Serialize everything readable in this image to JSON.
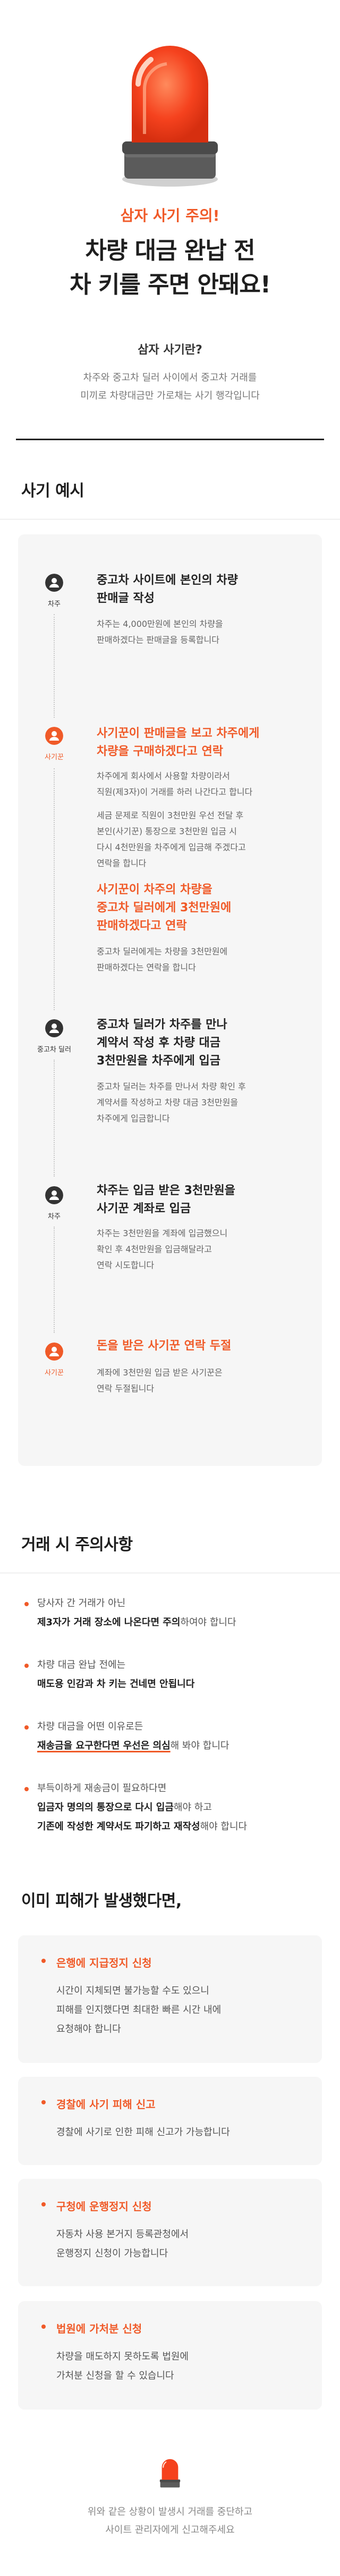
{
  "hero": {
    "subtitle": "삼자 사기 주의!",
    "title_line1": "차량 대금 완납 전",
    "title_line2": "차 키를 주면 안돼요!",
    "question": "삼자 사기란?",
    "answer_line1": "차주와 중고차 딜러 사이에서 중고차 거래를",
    "answer_line2": "미끼로 차량대금만 가로채는 사기 행각입니다"
  },
  "example": {
    "title": "사기 예시",
    "steps": [
      {
        "actor": "차주",
        "actor_highlight": false,
        "title": [
          "중고차 사이트에 본인의 차량",
          "판매글 작성"
        ],
        "desc": [
          [
            "차주는 4,000만원에 본인의 차량을",
            "판매하겠다는 판매글을 등록합니다"
          ]
        ]
      },
      {
        "actor": "사기꾼",
        "actor_highlight": true,
        "title": [
          "사기꾼이 판매글을 보고 차주에게",
          "차량을 구매하겠다고 연락"
        ],
        "desc": [
          [
            "차주에게 회사에서 사용할 차량이라서",
            "직원(제3자)이 거래를 하러 나간다고 합니다"
          ],
          [
            "세금 문제로 직원이 3천만원 우선 전달 후",
            "본인(사기꾼) 통장으로 3천만원 입금 시",
            "다시 4천만원을 차주에게 입금해 주겠다고",
            "연락을 합니다"
          ]
        ]
      },
      {
        "title": [
          "사기꾼이 차주의 차량을",
          "중고차 딜러에게 3천만원에",
          "판매하겠다고 연락"
        ],
        "desc": [
          [
            "중고차 딜러에게는 차량을 3천만원에",
            "판매하겠다는 연락을 합니다"
          ]
        ]
      },
      {
        "actor": "중고차 딜러",
        "actor_highlight": false,
        "title": [
          "중고차 딜러가 차주를 만나",
          "계약서 작성 후 차량 대금",
          "3천만원을 차주에게 입금"
        ],
        "desc": [
          [
            "중고차 딜러는 차주를 만나서 차량 확인 후",
            "계약서를 작성하고 차량 대금 3천만원을",
            "차주에게 입금합니다"
          ]
        ]
      },
      {
        "actor": "차주",
        "actor_highlight": false,
        "title": [
          "차주는 입금 받은 3천만원을",
          "사기꾼 계좌로 입금"
        ],
        "desc": [
          [
            "차주는 3천만원을 계좌에 입금했으니",
            "확인 후 4천만원을 입금해달라고",
            "연락 시도합니다"
          ]
        ]
      },
      {
        "actor": "사기꾼",
        "actor_highlight": true,
        "title": [
          "돈을 받은 사기꾼 연락 두절"
        ],
        "desc": [
          [
            "계좌에 3천만원 입금 받은 사기꾼은",
            "연락 두절됩니다"
          ]
        ]
      }
    ]
  },
  "caution": {
    "title": "거래 시 주의사항",
    "i1_a": "당사자 간 거래가 아닌",
    "i1_b1": "제3자가 거래 장소에 나온다면 주의",
    "i1_b2": "하여야 합니다",
    "i2_a": "차량 대금 완납 전에는",
    "i2_b": "매도용 인감과 차 키는 건네면 안됩니다",
    "i3_a": "차량 대금을 어떤 이유로든",
    "i3_b1": "재송금을 요구한다면 우선은 의심",
    "i3_b2": "해 봐야 합니다",
    "i4_a": "부득이하게 재송금이 필요하다면",
    "i4_b1": "입금자 명의의 통장으로 다시 입금",
    "i4_b2": "해야 하고",
    "i4_c1": "기존에 작성한 계약서도 파기하고 재작성",
    "i4_c2": "해야 합니다"
  },
  "damage": {
    "title": "이미 피해가 발생했다면,",
    "items": [
      {
        "title": "은행에 지급정지 신청",
        "desc": [
          "시간이 지체되면 불가능할 수도 있으니",
          "피해를 인지했다면 최대한 빠른 시간 내에",
          "요청해야 합니다"
        ]
      },
      {
        "title": "경찰에 사기 피해 신고",
        "desc": [
          "경찰에 사기로 인한 피해 신고가 가능합니다"
        ]
      },
      {
        "title": "구청에 운행정지 신청",
        "desc": [
          "자동차 사용 본거지 등록관청에서",
          "운행정지 신청이 가능합니다"
        ]
      },
      {
        "title": "법원에 가처분 신청",
        "desc": [
          "차량을 매도하지 못하도록 법원에",
          "가처분 신청을 할 수 있습니다"
        ]
      }
    ]
  },
  "footer": {
    "line1": "위와 같은 상황이 발생시 거래를 중단하고",
    "line2": "사이트 관리자에게 신고해주세요"
  },
  "colors": {
    "accent": "#f05a28",
    "text": "#1e1e1e",
    "muted": "#666666",
    "card": "#f6f6f6"
  }
}
